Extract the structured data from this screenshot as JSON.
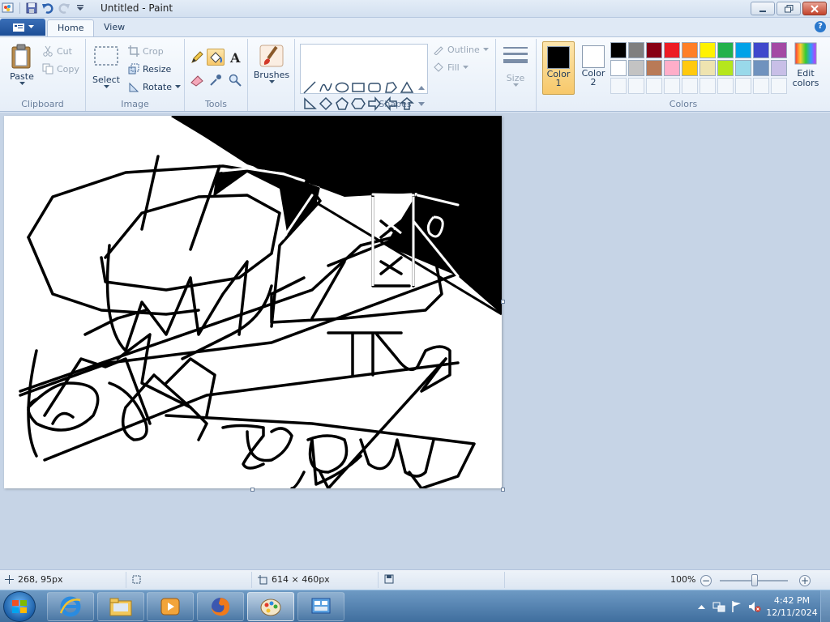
{
  "window": {
    "title": "Untitled - Paint"
  },
  "tabs": [
    {
      "label": "Home"
    },
    {
      "label": "View"
    }
  ],
  "clipboard": {
    "paste": "Paste",
    "cut": "Cut",
    "copy": "Copy",
    "label": "Clipboard"
  },
  "image": {
    "select": "Select",
    "crop": "Crop",
    "resize": "Resize",
    "rotate": "Rotate",
    "label": "Image"
  },
  "tools": {
    "label": "Tools",
    "active_tool": "fill-icon"
  },
  "brushes": {
    "label": "Brushes"
  },
  "shapes": {
    "outline": "Outline",
    "fill": "Fill",
    "label": "Shapes"
  },
  "size": {
    "label": "Size"
  },
  "colors": {
    "color1_label_a": "Color",
    "color1_label_b": "1",
    "color2_label_a": "Color",
    "color2_label_b": "2",
    "color1": "#000000",
    "color2": "#ffffff",
    "edit": "Edit colors",
    "label": "Colors",
    "palette": [
      "#000000",
      "#7f7f7f",
      "#880015",
      "#ed1c24",
      "#ff7f27",
      "#fff200",
      "#22b14c",
      "#00a2e8",
      "#3f48cc",
      "#a349a4",
      "#ffffff",
      "#c3c3c3",
      "#b97a57",
      "#ffaec9",
      "#ffc90e",
      "#efe4b0",
      "#b5e61d",
      "#99d9ea",
      "#7092be",
      "#c8bfe7"
    ]
  },
  "status": {
    "cursor": "268, 95px",
    "selection": "",
    "canvas_size": "614 × 460px",
    "zoom": "100%"
  },
  "clock": {
    "time": "4:42 PM",
    "date": "12/11/2024"
  }
}
